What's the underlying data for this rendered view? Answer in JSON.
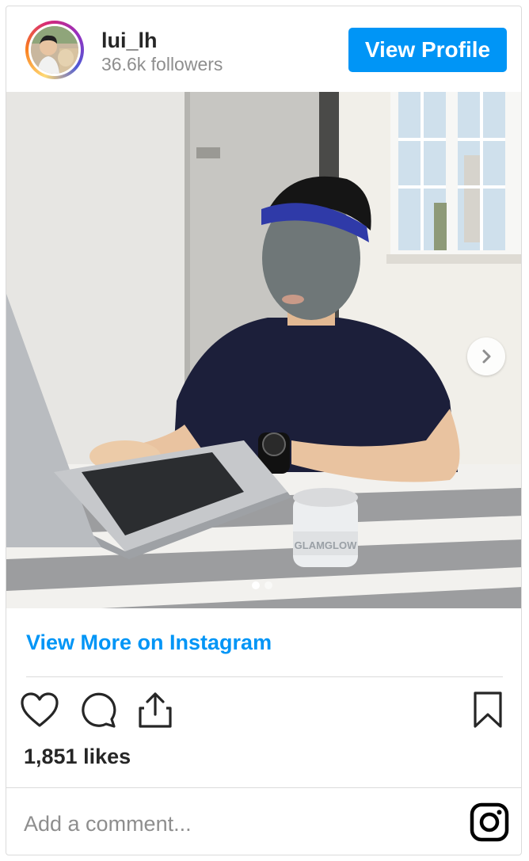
{
  "header": {
    "username": "lui_lh",
    "followers": "36.6k followers",
    "view_profile_label": "View Profile"
  },
  "post": {
    "carousel": {
      "slide_count": 2,
      "active_slide": 1
    },
    "view_more_label": "View More on Instagram",
    "likes": "1,851 likes",
    "jar_label": "GLAMGLOW"
  },
  "comment": {
    "placeholder": "Add a comment..."
  },
  "colors": {
    "accent": "#0095f6",
    "text": "#262626",
    "muted": "#8e8e8e",
    "border": "#dbdbdb"
  },
  "icons": {
    "like": "heart-icon",
    "comment": "comment-icon",
    "share": "share-icon",
    "save": "bookmark-icon",
    "next": "chevron-right-icon",
    "brand": "instagram-icon"
  }
}
